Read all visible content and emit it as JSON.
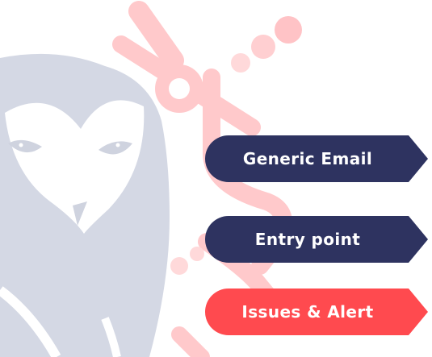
{
  "tags": [
    {
      "label": "Generic Email",
      "color": "#2e3360"
    },
    {
      "label": "Entry point",
      "color": "#2e3360"
    },
    {
      "label": "Issues & Alert",
      "color": "#ff4a4f"
    }
  ],
  "decor": {
    "owl_color": "#cfd3df",
    "path_color": "#ffb4b7"
  }
}
